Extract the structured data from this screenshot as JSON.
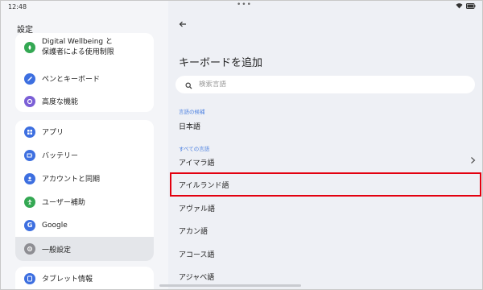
{
  "status": {
    "time": "12:48",
    "dots": "•••"
  },
  "left": {
    "title": "設定",
    "card1": [
      {
        "label_line1": "Digital Wellbeing と",
        "label_line2": "保護者による使用制限",
        "icon": "wellbeing-icon",
        "color": "#34a853"
      },
      {
        "label": "ペンとキーボード",
        "icon": "pen-icon",
        "color": "#3d6fe0"
      },
      {
        "label": "高度な機能",
        "icon": "advanced-icon",
        "color": "#7b5fd6"
      }
    ],
    "card2": [
      {
        "label": "アプリ",
        "icon": "apps-icon",
        "color": "#3d6fe0"
      },
      {
        "label": "バッテリー",
        "icon": "battery-icon",
        "color": "#3d6fe0"
      },
      {
        "label": "アカウントと同期",
        "icon": "account-icon",
        "color": "#3d6fe0"
      },
      {
        "label": "ユーザー補助",
        "icon": "accessibility-icon",
        "color": "#34a853"
      },
      {
        "label": "Google",
        "icon": "google-icon",
        "color": "#3d6fe0"
      },
      {
        "label": "一般設定",
        "icon": "general-settings-icon",
        "color": "#8e8e93",
        "selected": true
      }
    ],
    "card3": [
      {
        "label": "タブレット情報",
        "icon": "tablet-info-icon",
        "color": "#3d6fe0"
      }
    ]
  },
  "right": {
    "title": "キーボードを追加",
    "search_placeholder": "検索言語",
    "section_suggested": "言語の候補",
    "suggested": [
      "日本語"
    ],
    "section_all": "すべての言語",
    "languages": [
      "アイマラ語",
      "アイルランド語",
      "アヴァル語",
      "アカン語",
      "アコース語",
      "アジャベ語"
    ]
  },
  "colors": {
    "accent": "#4a7fe0",
    "highlight_border": "#e3000f"
  }
}
